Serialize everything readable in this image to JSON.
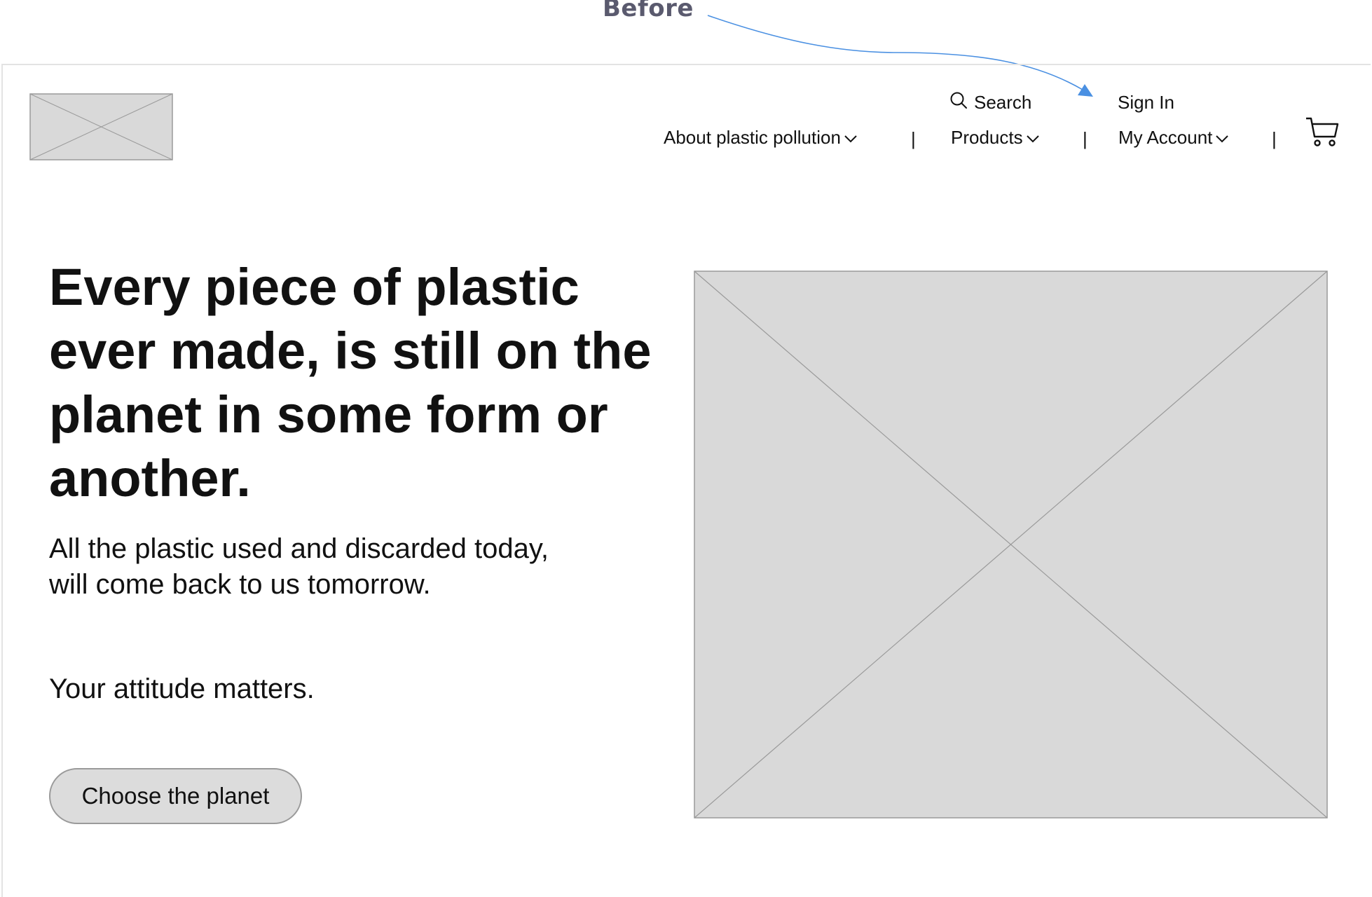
{
  "annotation": {
    "label": "Before",
    "arrow_color": "#4a90e2"
  },
  "header": {
    "logo": "image-placeholder-icon",
    "utility_nav": {
      "search_label": "Search",
      "sign_in_label": "Sign In"
    },
    "main_nav": {
      "items": [
        {
          "label": "About plastic pollution",
          "icon": "chevron-down-icon"
        },
        {
          "label": "Products",
          "icon": "chevron-down-icon"
        },
        {
          "label": "My Account",
          "icon": "chevron-down-icon"
        }
      ],
      "separator": "|",
      "cart_icon": "cart-icon"
    }
  },
  "hero": {
    "headline": "Every piece of plastic ever made, is still on the planet in some form or another.",
    "subtext": "All the plastic used and discarded today, will come back to us tomorrow.",
    "attitude": "Your attitude matters.",
    "cta_label": "Choose the planet",
    "image": "image-placeholder-icon"
  },
  "colors": {
    "placeholder_fill": "#d9d9d9",
    "placeholder_stroke": "#9a9a9a",
    "button_fill": "#dcdcdc",
    "text": "#111111"
  }
}
